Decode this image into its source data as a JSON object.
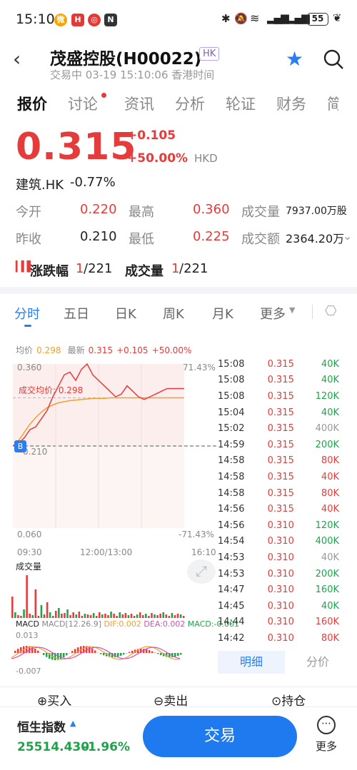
{
  "status": {
    "time": "15:10",
    "battery": "55",
    "icons": [
      "weibo-icon",
      "app-icon",
      "app-icon",
      "nfc-icon",
      "bluetooth-icon",
      "mute-icon",
      "wifi-icon",
      "signal-icon",
      "signal-icon",
      "battery-icon",
      "leaf-icon"
    ]
  },
  "header": {
    "title": "茂盛控股(H00022)",
    "market_badge": "HK",
    "subtitle": "交易中 03-19 15:10:06 香港时间"
  },
  "tabs": [
    "报价",
    "讨论",
    "资讯",
    "分析",
    "轮证",
    "财务",
    "简"
  ],
  "quote": {
    "price": "0.315",
    "change": "+0.105",
    "change_pct": "+50.00%",
    "currency": "HKD",
    "sector": "建筑.HK",
    "sector_change": "-0.77%"
  },
  "stats": [
    {
      "label": "今开",
      "value": "0.220",
      "label2": "最高",
      "value2": "0.360",
      "label3": "成交量",
      "value3": "7937.00万股"
    },
    {
      "label": "昨收",
      "value": "0.210",
      "label2": "最低",
      "value2": "0.225",
      "label3": "成交额",
      "value3": "2364.20万"
    }
  ],
  "rank": {
    "label1": "涨跌幅",
    "rank1": "1",
    "total1": "/221",
    "label2": "成交量",
    "rank2": "1",
    "total2": "/221"
  },
  "time_tabs": [
    "分时",
    "五日",
    "日K",
    "周K",
    "月K",
    "更多"
  ],
  "chart_info": {
    "avg_label": "均价",
    "avg": "0.298",
    "latest_label": "最新",
    "latest": "0.315",
    "chg": "+0.105",
    "pct": "+50.00%"
  },
  "chart_axis": {
    "y_top": "0.360",
    "y_bottom": "0.060",
    "y_ref": "0.210",
    "pct_top": "71.43%",
    "pct_bottom": "-71.43%",
    "x_start": "09:30",
    "x_mid": "12:00/13:00",
    "x_end": "16:10",
    "avg_line_label": "成交均价: 0.298",
    "b_marker": "B"
  },
  "volume_label": "成交量",
  "macd": {
    "label": "MACD",
    "params": "MACD[12.26.9]",
    "dif": "DIF:0.002",
    "dea": "DEA:0.002",
    "macd": "MACD:-0.001",
    "top": "0.013",
    "bottom": "-0.007"
  },
  "chart_data": {
    "type": "line",
    "x_range": [
      "09:30",
      "16:10"
    ],
    "ylim": [
      0.06,
      0.36
    ],
    "ref": 0.21,
    "price": [
      0.21,
      0.215,
      0.225,
      0.24,
      0.245,
      0.26,
      0.275,
      0.3,
      0.32,
      0.34,
      0.345,
      0.33,
      0.35,
      0.36,
      0.34,
      0.33,
      0.32,
      0.31,
      0.3,
      0.305,
      0.32,
      0.31,
      0.3,
      0.295,
      0.3,
      0.305,
      0.31,
      0.315,
      0.315,
      0.315,
      0.315
    ],
    "avg": [
      0.21,
      0.22,
      0.235,
      0.25,
      0.262,
      0.272,
      0.28,
      0.285,
      0.289,
      0.291,
      0.293,
      0.294,
      0.295,
      0.296,
      0.297,
      0.297,
      0.297,
      0.298,
      0.298,
      0.298,
      0.298,
      0.298,
      0.298,
      0.298,
      0.298,
      0.298,
      0.298,
      0.298,
      0.298,
      0.298,
      0.298
    ]
  },
  "ticks": [
    {
      "t": "15:08",
      "p": "0.315",
      "v": "40K",
      "c": "green"
    },
    {
      "t": "15:08",
      "p": "0.315",
      "v": "40K",
      "c": "green"
    },
    {
      "t": "15:08",
      "p": "0.315",
      "v": "120K",
      "c": "green"
    },
    {
      "t": "15:04",
      "p": "0.315",
      "v": "40K",
      "c": "green"
    },
    {
      "t": "15:02",
      "p": "0.315",
      "v": "400K",
      "c": "gray"
    },
    {
      "t": "14:59",
      "p": "0.315",
      "v": "200K",
      "c": "green"
    },
    {
      "t": "14:58",
      "p": "0.315",
      "v": "80K",
      "c": "red"
    },
    {
      "t": "14:58",
      "p": "0.315",
      "v": "40K",
      "c": "red"
    },
    {
      "t": "14:58",
      "p": "0.315",
      "v": "80K",
      "c": "red"
    },
    {
      "t": "14:56",
      "p": "0.315",
      "v": "40K",
      "c": "red"
    },
    {
      "t": "14:56",
      "p": "0.310",
      "v": "120K",
      "c": "green"
    },
    {
      "t": "14:54",
      "p": "0.310",
      "v": "400K",
      "c": "green"
    },
    {
      "t": "14:53",
      "p": "0.310",
      "v": "40K",
      "c": "gray"
    },
    {
      "t": "14:53",
      "p": "0.310",
      "v": "200K",
      "c": "green"
    },
    {
      "t": "14:47",
      "p": "0.310",
      "v": "160K",
      "c": "green"
    },
    {
      "t": "14:45",
      "p": "0.310",
      "v": "40K",
      "c": "green"
    },
    {
      "t": "14:44",
      "p": "0.310",
      "v": "160K",
      "c": "red"
    },
    {
      "t": "14:42",
      "p": "0.310",
      "v": "80K",
      "c": "red"
    }
  ],
  "detail_tabs": [
    "明细",
    "分价"
  ],
  "actions": [
    "买入",
    "卖出",
    "持仓"
  ],
  "bottom": {
    "index_name": "恒生指数",
    "index_value": "25514.430",
    "index_change": "-1.96%",
    "trade": "交易",
    "more": "更多"
  }
}
